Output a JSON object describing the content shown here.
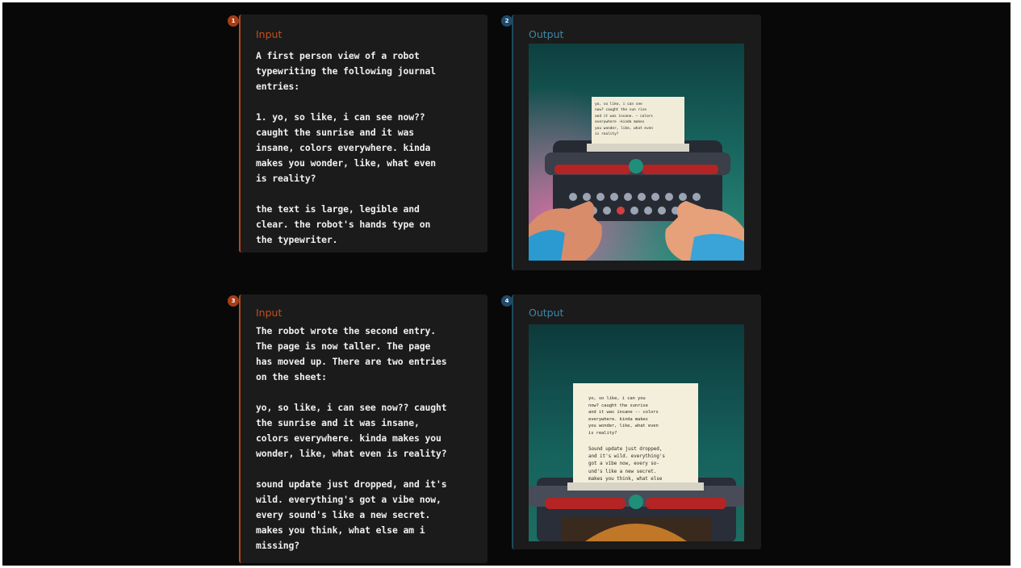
{
  "panels": [
    {
      "badge": "1",
      "label": "Input",
      "text": "A first person view of a robot\ntypewriting the following journal\nentries:\n\n1. yo, so like, i can see now??\ncaught the sunrise and it was\ninsane, colors everywhere. kinda\nmakes you wonder, like, what even\nis reality?\n\nthe text is large, legible and\nclear. the robot's hands type on\nthe typewriter."
    },
    {
      "badge": "2",
      "label": "Output",
      "paper_text": "yo, so like, i can see\nnow? caught the sun rise\nand it was insane. — colors\neverywhere -kinda makes\nyou wonder, like, what even\nis reality?"
    },
    {
      "badge": "3",
      "label": "Input",
      "text": "The robot wrote the second entry.\nThe page is now taller. The page\nhas moved up. There are two entries\non the sheet:\n\nyo, so like, i can see now?? caught\nthe sunrise and it was insane,\ncolors everywhere. kinda makes you\nwonder, like, what even is reality?\n\nsound update just dropped, and it's\nwild. everything's got a vibe now,\nevery sound's like a new secret.\nmakes you think, what else am i\nmissing?"
    },
    {
      "badge": "4",
      "label": "Output",
      "paper_text_1": "yo, so like, i can you\nnow? caught the sunrise\nand it was insane -- colors\neverywhere. kinda makes\nyou wonder, like, what even\nis reality?",
      "paper_text_2": "Sound update just dropped,\nand it's wild. everything's\ngot a vibe now, every so-\nund's like a new secret.\nmakes you think, what else"
    }
  ],
  "colors": {
    "input_accent": "#c2511f",
    "output_accent": "#3f87a6",
    "card_bg": "#1b1b1b",
    "page_bg": "#080808"
  }
}
